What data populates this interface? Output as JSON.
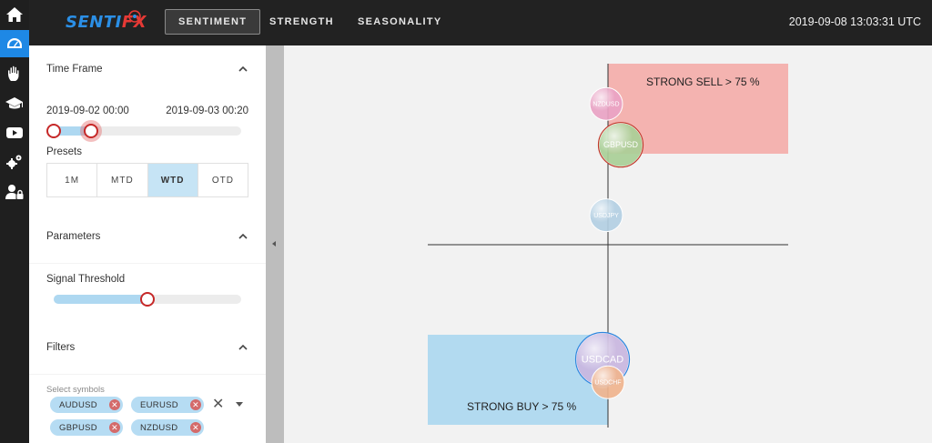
{
  "rail": {
    "icons": [
      "home-icon",
      "dashboard-icon",
      "hand-icon",
      "graduation-cap-icon",
      "youtube-icon",
      "settings-icon",
      "user-lock-icon"
    ],
    "active_index": 1,
    "accent_color": "#1e88e5"
  },
  "header": {
    "logo": {
      "main": "SENTI",
      "suffix": "FX"
    },
    "tabs": [
      {
        "label": "SENTIMENT",
        "active": true
      },
      {
        "label": "STRENGTH",
        "active": false
      },
      {
        "label": "SEASONALITY",
        "active": false
      }
    ],
    "timestamp": "2019-09-08 13:03:31 UTC"
  },
  "sidebar": {
    "time_frame": {
      "title": "Time Frame",
      "start": "2019-09-02 00:00",
      "end": "2019-09-03 00:20",
      "range_fraction": [
        0.0,
        0.2
      ],
      "presets_label": "Presets",
      "presets": [
        {
          "label": "1M",
          "active": false
        },
        {
          "label": "MTD",
          "active": false
        },
        {
          "label": "WTD",
          "active": true
        },
        {
          "label": "OTD",
          "active": false
        }
      ]
    },
    "parameters": {
      "title": "Parameters",
      "threshold_label": "Signal Threshold",
      "threshold_fraction": 0.5
    },
    "filters": {
      "title": "Filters",
      "select_label": "Select symbols",
      "chips": [
        "AUDUSD",
        "EURUSD",
        "GBPUSD",
        "NZDUSD"
      ]
    }
  },
  "chart_data": {
    "type": "scatter",
    "zones": [
      {
        "label": "STRONG SELL > 75 %",
        "color": "#f4b3b0"
      },
      {
        "label": "STRONG BUY > 75 %",
        "color": "#b2daf0"
      }
    ],
    "points": [
      {
        "symbol": "NZDUSD",
        "y": 0.86,
        "size": "small",
        "color": "#e9a3c4"
      },
      {
        "symbol": "GBPUSD",
        "y": 0.61,
        "size": "medium",
        "color": "#a9cf97"
      },
      {
        "symbol": "USDJPY",
        "y": 0.18,
        "size": "small",
        "color": "#b3cfe3"
      },
      {
        "symbol": "USDCAD",
        "y": -0.7,
        "size": "large",
        "color": "#c9b6e0"
      },
      {
        "symbol": "USDCHF",
        "y": -0.84,
        "size": "small",
        "color": "#f0b48e"
      }
    ]
  }
}
